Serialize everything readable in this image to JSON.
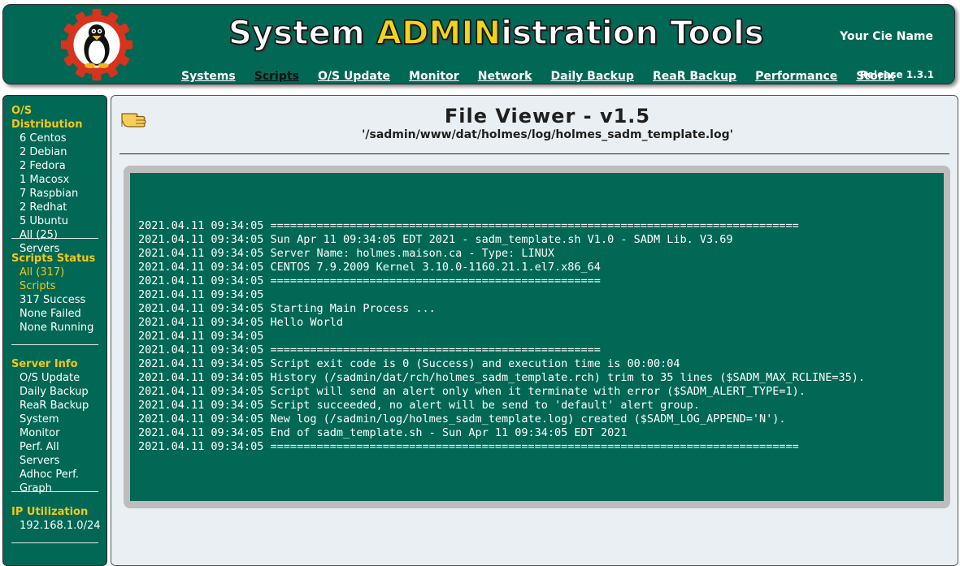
{
  "header": {
    "title_part1": "System ",
    "title_part2": "ADMIN",
    "title_part3": "istration Tools",
    "company": "Your Cie Name",
    "release": "Release 1.3.1",
    "nav": [
      {
        "label": "Systems"
      },
      {
        "label": "Scripts",
        "active": true
      },
      {
        "label": "O/S Update"
      },
      {
        "label": "Monitor"
      },
      {
        "label": "Network"
      },
      {
        "label": "Daily Backup"
      },
      {
        "label": "ReaR Backup"
      },
      {
        "label": "Performance"
      },
      {
        "label": "Storix"
      }
    ],
    "logo_icon": "tux-gear-icon"
  },
  "sidebar": {
    "os_distribution": {
      "title": "O/S Distribution",
      "items": [
        "6 Centos",
        "2 Debian",
        "2 Fedora",
        "1 Macosx",
        "7 Raspbian",
        "2 Redhat",
        "5 Ubuntu",
        "All (25) Servers"
      ]
    },
    "scripts_status": {
      "title": "Scripts Status",
      "items": [
        "All (317)",
        "Scripts",
        "317 Success",
        "None Failed",
        "None Running"
      ]
    },
    "server_info": {
      "title": "Server Info",
      "items": [
        "O/S Update",
        "Daily Backup",
        "ReaR Backup",
        "System Monitor",
        "Perf. All",
        "Servers",
        "Adhoc Perf.",
        "Graph"
      ]
    },
    "ip_utilization": {
      "title": "IP Utilization",
      "items": [
        "192.168.1.0/24"
      ]
    }
  },
  "main": {
    "icon": "pointing-hand-icon",
    "title": "File Viewer - v1.5",
    "subtitle": "'/sadmin/www/dat/holmes/log/holmes_sadm_template.log'",
    "log_lines": [
      "2021.04.11 09:34:05 ================================================================================",
      "2021.04.11 09:34:05 Sun Apr 11 09:34:05 EDT 2021 - sadm_template.sh V1.0 - SADM Lib. V3.69",
      "2021.04.11 09:34:05 Server Name: holmes.maison.ca - Type: LINUX",
      "2021.04.11 09:34:05 CENTOS 7.9.2009 Kernel 3.10.0-1160.21.1.el7.x86_64",
      "2021.04.11 09:34:05 ==================================================",
      "2021.04.11 09:34:05 ",
      "2021.04.11 09:34:05 Starting Main Process ...",
      "2021.04.11 09:34:05 Hello World",
      "2021.04.11 09:34:05 ",
      "2021.04.11 09:34:05 ==================================================",
      "2021.04.11 09:34:05 Script exit code is 0 (Success) and execution time is 00:00:04",
      "2021.04.11 09:34:05 History (/sadmin/dat/rch/holmes_sadm_template.rch) trim to 35 lines ($SADM_MAX_RCLINE=35).",
      "2021.04.11 09:34:05 Script will send an alert only when it terminate with error ($SADM_ALERT_TYPE=1).",
      "2021.04.11 09:34:05 Script succeeded, no alert will be send to 'default' alert group.",
      "2021.04.11 09:34:05 New log (/sadmin/log/holmes_sadm_template.log) created ($SADM_LOG_APPEND='N').",
      "2021.04.11 09:34:05 End of sadm_template.sh - Sun Apr 11 09:34:05 EDT 2021",
      "2021.04.11 09:34:05 ================================================================================"
    ]
  },
  "colors": {
    "brand_green": "#006855",
    "accent_yellow": "#f2c81b",
    "page_bg": "#e9eff3"
  }
}
